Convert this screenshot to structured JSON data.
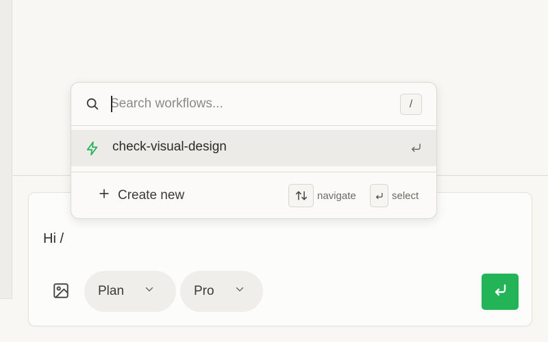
{
  "composer": {
    "text": "Hi /",
    "plan_pill": {
      "label": "Plan"
    },
    "pro_pill": {
      "label": "Pro"
    }
  },
  "workflow_popup": {
    "search": {
      "placeholder": "Search workflows...",
      "value": "",
      "shortcut": "/"
    },
    "items": [
      {
        "label": "check-visual-design",
        "icon": "bolt-icon",
        "highlighted": true
      }
    ],
    "create_new_label": "Create new",
    "hints": {
      "navigate": "navigate",
      "select": "select"
    }
  },
  "colors": {
    "accent": "#22b456",
    "bolt": "#2ab45e",
    "background": "#f8f7f4",
    "popup": "#fbfaf8",
    "highlight": "#ecebe8"
  }
}
